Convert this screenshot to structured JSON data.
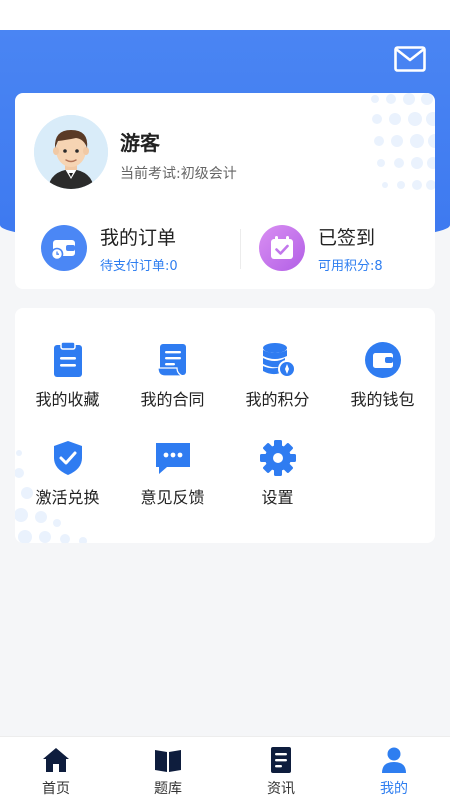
{
  "user": {
    "name": "游客",
    "exam_label": "当前考试:",
    "exam_value": "初级会计"
  },
  "stats": {
    "orders": {
      "title": "我的订单",
      "sub_label": "待支付订单:",
      "sub_value": "0"
    },
    "signin": {
      "title": "已签到",
      "sub_label": "可用积分:",
      "sub_value": "8"
    }
  },
  "menu": {
    "items": [
      {
        "label": "我的收藏",
        "icon": "clipboard-icon"
      },
      {
        "label": "我的合同",
        "icon": "scroll-icon"
      },
      {
        "label": "我的积分",
        "icon": "coins-icon"
      },
      {
        "label": "我的钱包",
        "icon": "wallet-icon"
      },
      {
        "label": "激活兑换",
        "icon": "shield-check-icon"
      },
      {
        "label": "意见反馈",
        "icon": "chat-bubble-icon"
      },
      {
        "label": "设置",
        "icon": "gear-icon"
      }
    ]
  },
  "tabbar": {
    "items": [
      {
        "label": "首页",
        "icon": "home-icon"
      },
      {
        "label": "题库",
        "icon": "book-icon"
      },
      {
        "label": "资讯",
        "icon": "news-icon"
      },
      {
        "label": "我的",
        "icon": "person-icon",
        "active": true
      }
    ]
  },
  "colors": {
    "primary": "#3d79f0",
    "link": "#2e7ef0",
    "sign_icon": "#c277ec",
    "tab_inactive": "#0e1d3d"
  }
}
